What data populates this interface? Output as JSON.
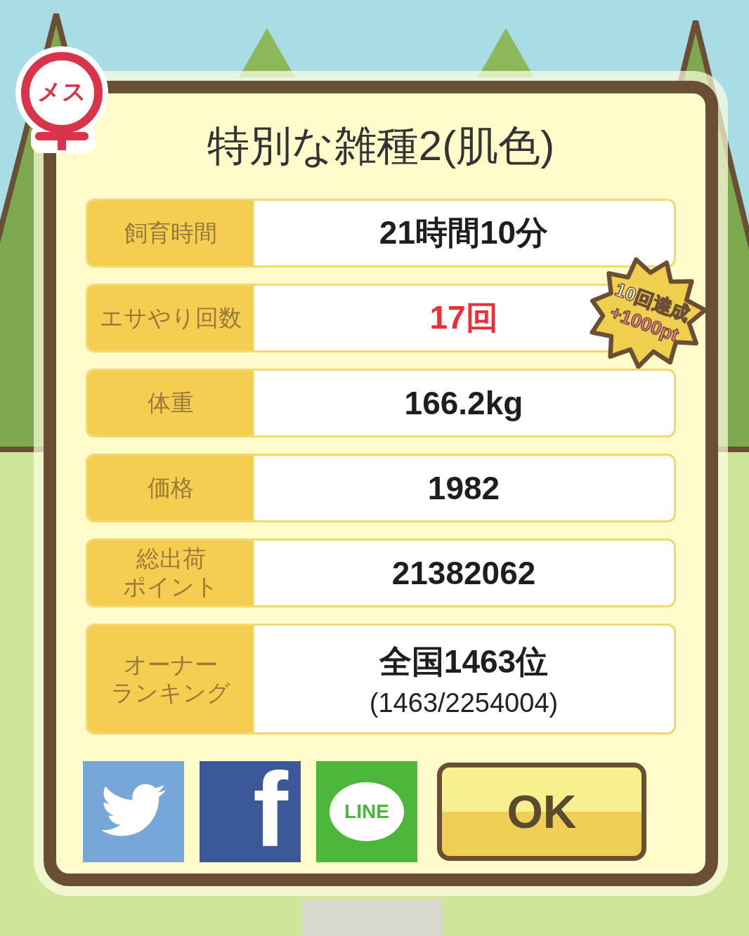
{
  "gender_badge": {
    "label": "メス"
  },
  "title": "特別な雑種2(肌色)",
  "stats": [
    {
      "label": "飼育時間",
      "value": "21時間10分",
      "highlight": false
    },
    {
      "label": "エサやり回数",
      "value": "17回",
      "highlight": true,
      "badge": {
        "line_1": "10回達成",
        "line_2": "+1000pt"
      }
    },
    {
      "label": "体重",
      "value": "166.2kg",
      "highlight": false
    },
    {
      "label": "価格",
      "value": "1982",
      "highlight": false
    },
    {
      "label_lines": [
        "総出荷",
        "ポイント"
      ],
      "value": "21382062",
      "highlight": false
    },
    {
      "label_lines": [
        "オーナー",
        "ランキング"
      ],
      "value": "全国1463位",
      "subvalue": "(1463/2254004)",
      "highlight": false
    }
  ],
  "share_buttons": [
    {
      "kind": "twitter"
    },
    {
      "kind": "facebook",
      "logo_text": "f"
    },
    {
      "kind": "line",
      "logo_text": "LINE"
    }
  ],
  "ok_button": {
    "label": "OK"
  }
}
